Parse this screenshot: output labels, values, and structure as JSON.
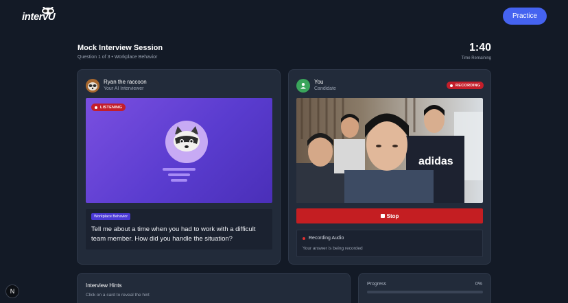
{
  "header": {
    "logo_text": "intervU",
    "practice_label": "Practice"
  },
  "session": {
    "title": "Mock Interview Session",
    "subtitle": "Question 1 of 3 • Workplace Behavior",
    "timer": "1:40",
    "timer_label": "Time Remaining"
  },
  "interviewer": {
    "name": "Ryan the raccoon",
    "role": "Your AI Interviewer",
    "status_badge": "LISTENING",
    "question_tag": "Workplace Behavior",
    "question": "Tell me about a time when you had to work with a difficult team member. How did you handle the situation?"
  },
  "candidate": {
    "name": "You",
    "role": "Candidate",
    "status_badge": "RECORDING",
    "stop_label": "Stop",
    "recording_title": "Recording Audio",
    "recording_sub": "Your answer is being recorded",
    "shirt_text": "adidas"
  },
  "hints": {
    "title": "Interview Hints",
    "subtitle": "Click on a card to reveal the hint"
  },
  "progress": {
    "label": "Progress",
    "value_text": "0%",
    "value": 0
  },
  "dev_badge": "N",
  "colors": {
    "accent": "#4563f0",
    "recording": "#c41e22",
    "background": "#131a26",
    "card": "#222b3a"
  }
}
